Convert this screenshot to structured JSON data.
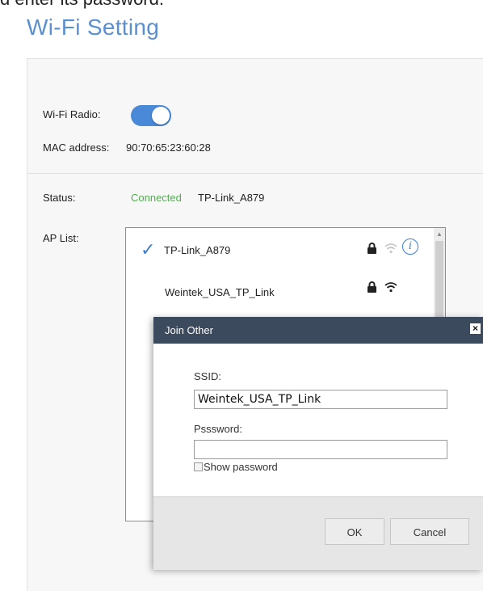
{
  "caption_fragment": "d enter its password.",
  "page": {
    "title": "Wi-Fi Setting"
  },
  "wifi": {
    "radio_label": "Wi-Fi Radio:",
    "radio_on": true,
    "mac_label": "MAC address:",
    "mac_value": "90:70:65:23:60:28"
  },
  "status": {
    "label": "Status:",
    "state": "Connected",
    "network": "TP-Link_A879"
  },
  "ap_list": {
    "label": "AP List:",
    "items": [
      {
        "name": "TP-Link_A879",
        "connected": true,
        "secured": true,
        "signal": "weak",
        "has_info": true
      },
      {
        "name": "Weintek_USA_TP_Link",
        "connected": false,
        "secured": true,
        "signal": "strong",
        "has_info": false
      }
    ]
  },
  "dialog": {
    "title": "Join Other",
    "close_glyph": "×",
    "ssid_label": "SSID:",
    "ssid_value": "Weintek_USA_TP_Link",
    "password_label": "Psssword:",
    "password_value": "",
    "show_password_label": "Show password",
    "show_password_checked": false,
    "ok_label": "OK",
    "cancel_label": "Cancel"
  },
  "colors": {
    "accent": "#4a88d8",
    "connected": "#4fae4f",
    "dialog_header": "#3b4a5c"
  }
}
